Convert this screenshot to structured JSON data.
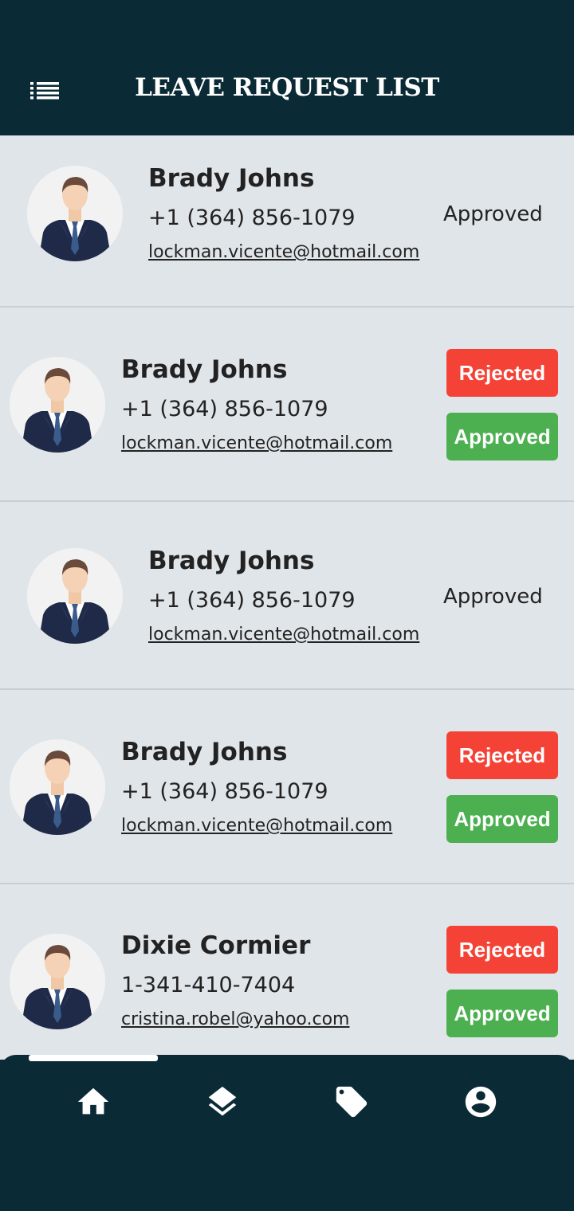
{
  "header": {
    "title": "LEAVE REQUEST LIST",
    "menu_icon": "list-icon"
  },
  "requests": [
    {
      "name": "Brady Johns",
      "phone": "+1 (364) 856-1079",
      "email": "lockman.vicente@hotmail.com",
      "status": "Approved"
    },
    {
      "name": "Brady Johns",
      "phone": "+1 (364) 856-1079",
      "email": "lockman.vicente@hotmail.com",
      "reject_label": "Rejected",
      "approve_label": "Approved"
    },
    {
      "name": "Brady Johns",
      "phone": "+1 (364) 856-1079",
      "email": "lockman.vicente@hotmail.com",
      "status": "Approved"
    },
    {
      "name": "Brady Johns",
      "phone": "+1 (364) 856-1079",
      "email": "lockman.vicente@hotmail.com",
      "reject_label": "Rejected",
      "approve_label": "Approved"
    },
    {
      "name": "Dixie Cormier",
      "phone": "1-341-410-7404",
      "email": "cristina.robel@yahoo.com",
      "reject_label": "Rejected",
      "approve_label": "Approved"
    }
  ],
  "bottom_nav": {
    "items": [
      {
        "icon": "home-icon",
        "active": true
      },
      {
        "icon": "layers-icon",
        "active": false
      },
      {
        "icon": "tag-icon",
        "active": false
      },
      {
        "icon": "account-circle-icon",
        "active": false
      }
    ]
  },
  "colors": {
    "primary_dark": "#0a2b36",
    "list_background": "#e0e5e9",
    "reject": "#f44336",
    "approve": "#4caf50"
  }
}
